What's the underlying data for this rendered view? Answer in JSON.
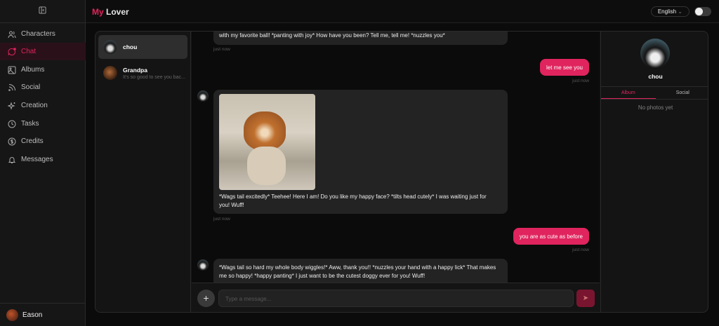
{
  "app": {
    "logo_my": "My",
    "logo_lover": "Lover",
    "language": "English"
  },
  "sidebar": {
    "items": [
      {
        "label": "Characters",
        "icon": "users-icon"
      },
      {
        "label": "Chat",
        "icon": "chat-icon"
      },
      {
        "label": "Albums",
        "icon": "image-icon"
      },
      {
        "label": "Social",
        "icon": "rss-icon"
      },
      {
        "label": "Creation",
        "icon": "sparkles-icon"
      },
      {
        "label": "Tasks",
        "icon": "clock-icon"
      },
      {
        "label": "Credits",
        "icon": "dollar-icon"
      },
      {
        "label": "Messages",
        "icon": "bell-icon"
      }
    ],
    "user": "Eason"
  },
  "chats": [
    {
      "name": "chou",
      "preview": ""
    },
    {
      "name": "Grandpa",
      "preview": "It's so good to see you bac..."
    }
  ],
  "messages": [
    {
      "from": "bot",
      "text": "with my favorite ball! *panting with joy* How have you been? Tell me, tell me! *nuzzles you*",
      "time": "just now"
    },
    {
      "from": "user",
      "text": "let me see you",
      "time": "just now"
    },
    {
      "from": "bot",
      "text": "*Wags tail excitedly* Teehee! Here I am! Do you like my happy face? *tilts head cutely* I was waiting just for you! Wuff!",
      "time": "just now"
    },
    {
      "from": "user",
      "text": "you are as cute as before",
      "time": "just now"
    },
    {
      "from": "bot",
      "text": "*Wags tail so hard my whole body wiggles!* Aww, thank you!! *nuzzles your hand with a happy lick* That makes me so happy! *happy panting* I just want to be the cutest doggy ever for you! Wuff!"
    }
  ],
  "input": {
    "placeholder": "Type a message..."
  },
  "profile": {
    "name": "chou",
    "tabs": [
      "Album",
      "Social"
    ],
    "empty": "No photos yet"
  },
  "colors": {
    "accent": "#e0245e"
  }
}
